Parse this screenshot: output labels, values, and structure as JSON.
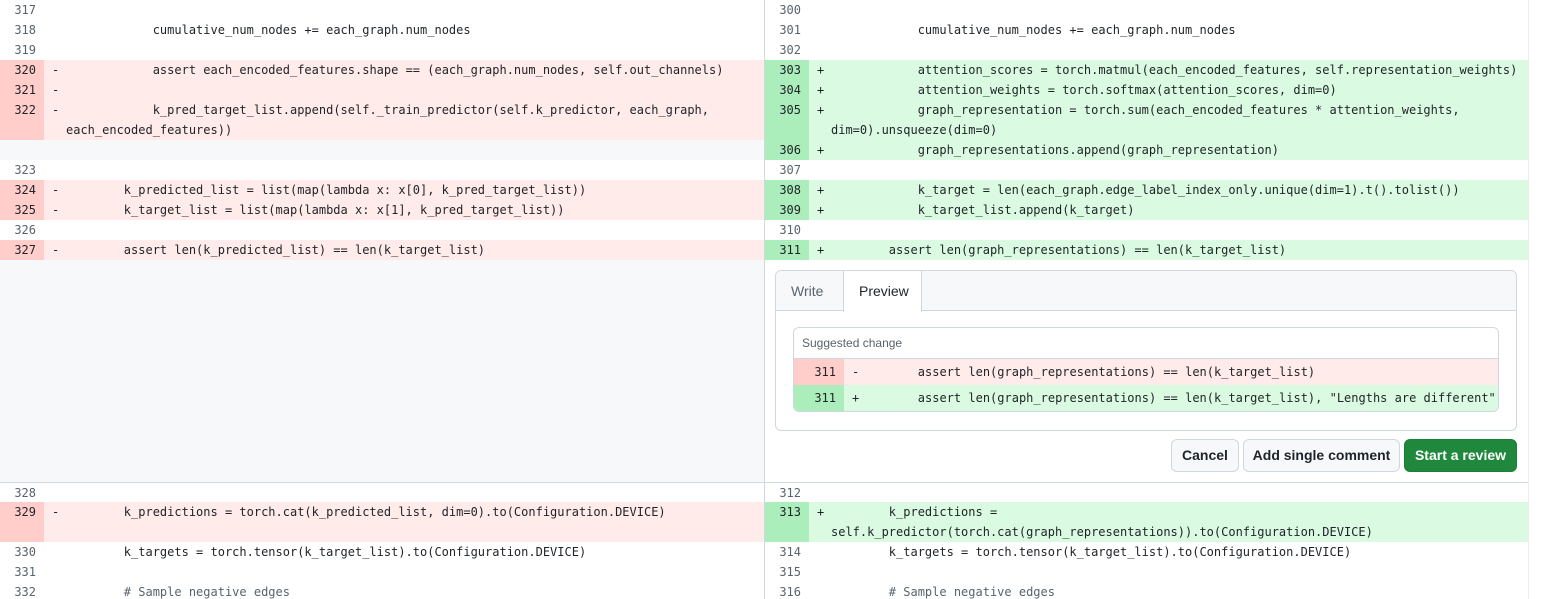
{
  "left": {
    "lines": [
      {
        "num": "317",
        "sign": "",
        "type": "ctx",
        "code": ""
      },
      {
        "num": "318",
        "sign": "",
        "type": "ctx",
        "code": "            cumulative_num_nodes += each_graph.num_nodes"
      },
      {
        "num": "319",
        "sign": "",
        "type": "ctx",
        "code": ""
      },
      {
        "num": "320",
        "sign": "-",
        "type": "del",
        "code": "            assert each_encoded_features.shape == (each_graph.num_nodes, self.out_channels)"
      },
      {
        "num": "321",
        "sign": "-",
        "type": "del",
        "code": ""
      },
      {
        "num": "322",
        "sign": "-",
        "type": "del",
        "code": "            k_pred_target_list.append(self._train_predictor(self.k_predictor, each_graph,",
        "code2": "each_encoded_features))"
      },
      {
        "num": "323",
        "sign": "",
        "type": "ctx",
        "code": ""
      },
      {
        "num": "324",
        "sign": "-",
        "type": "del",
        "code": "        k_predicted_list = list(map(lambda x: x[0], k_pred_target_list))"
      },
      {
        "num": "325",
        "sign": "-",
        "type": "del",
        "code": "        k_target_list = list(map(lambda x: x[1], k_pred_target_list))"
      },
      {
        "num": "326",
        "sign": "",
        "type": "ctx",
        "code": ""
      },
      {
        "num": "327",
        "sign": "-",
        "type": "del",
        "code": "        assert len(k_predicted_list) == len(k_target_list)"
      },
      {
        "num": "328",
        "sign": "",
        "type": "ctx",
        "code": ""
      },
      {
        "num": "329",
        "sign": "-",
        "type": "del",
        "code": "        k_predictions = torch.cat(k_predicted_list, dim=0).to(Configuration.DEVICE)"
      },
      {
        "num": "330",
        "sign": "",
        "type": "ctx",
        "code": "        k_targets = torch.tensor(k_target_list).to(Configuration.DEVICE)"
      },
      {
        "num": "331",
        "sign": "",
        "type": "ctx",
        "code": ""
      },
      {
        "num": "332",
        "sign": "",
        "type": "ctx",
        "code": "        # Sample negative edges"
      }
    ]
  },
  "right": {
    "lines": [
      {
        "num": "300",
        "sign": "",
        "type": "ctx",
        "code": ""
      },
      {
        "num": "301",
        "sign": "",
        "type": "ctx",
        "code": "            cumulative_num_nodes += each_graph.num_nodes"
      },
      {
        "num": "302",
        "sign": "",
        "type": "ctx",
        "code": ""
      },
      {
        "num": "303",
        "sign": "+",
        "type": "add",
        "code": "            attention_scores = torch.matmul(each_encoded_features, self.representation_weights)"
      },
      {
        "num": "304",
        "sign": "+",
        "type": "add",
        "code": "            attention_weights = torch.softmax(attention_scores, dim=0)"
      },
      {
        "num": "305",
        "sign": "+",
        "type": "add",
        "code": "            graph_representation = torch.sum(each_encoded_features * attention_weights,",
        "code2": "dim=0).unsqueeze(dim=0)"
      },
      {
        "num": "306",
        "sign": "+",
        "type": "add",
        "code": "            graph_representations.append(graph_representation)"
      },
      {
        "num": "307",
        "sign": "",
        "type": "ctx",
        "code": ""
      },
      {
        "num": "308",
        "sign": "+",
        "type": "add",
        "code": "            k_target = len(each_graph.edge_label_index_only.unique(dim=1).t().tolist())"
      },
      {
        "num": "309",
        "sign": "+",
        "type": "add",
        "code": "            k_target_list.append(k_target)"
      },
      {
        "num": "310",
        "sign": "",
        "type": "ctx",
        "code": ""
      },
      {
        "num": "311",
        "sign": "+",
        "type": "add",
        "code": "        assert len(graph_representations) == len(k_target_list)"
      },
      {
        "num": "312",
        "sign": "",
        "type": "ctx",
        "code": ""
      },
      {
        "num": "313",
        "sign": "+",
        "type": "add",
        "code": "        k_predictions =",
        "code2": "self.k_predictor(torch.cat(graph_representations)).to(Configuration.DEVICE)"
      },
      {
        "num": "314",
        "sign": "",
        "type": "ctx",
        "code": "        k_targets = torch.tensor(k_target_list).to(Configuration.DEVICE)"
      },
      {
        "num": "315",
        "sign": "",
        "type": "ctx",
        "code": ""
      },
      {
        "num": "316",
        "sign": "",
        "type": "ctx",
        "code": "        # Sample negative edges"
      }
    ]
  },
  "comment": {
    "tabs": {
      "write": "Write",
      "preview": "Preview"
    },
    "suggestion": {
      "header": "Suggested change",
      "del": {
        "num": "311",
        "sign": "-",
        "code": "        assert len(graph_representations) == len(k_target_list)"
      },
      "add": {
        "num": "311",
        "sign": "+",
        "code": "        assert len(graph_representations) == len(k_target_list), \"Lengths are different\""
      }
    },
    "buttons": {
      "cancel": "Cancel",
      "add_single": "Add single comment",
      "start_review": "Start a review"
    }
  },
  "colors": {
    "del_bg": "#ffebe9",
    "del_num_bg": "#ffcecb",
    "add_bg": "#dafbe1",
    "add_num_bg": "#aceebb",
    "primary_button": "#1f883d"
  }
}
